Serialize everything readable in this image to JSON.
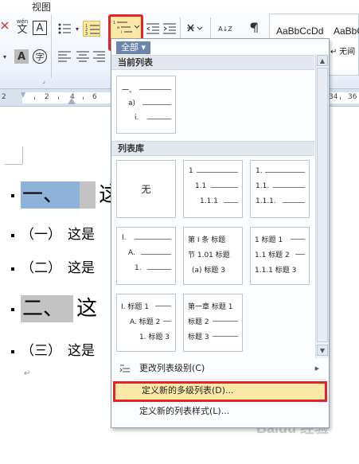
{
  "ribbon": {
    "menu_partial": "视图",
    "font_wen_label": "wén",
    "font_wen_char": "文",
    "char_border_label": "A",
    "char_shading_label": "A",
    "enclosed_char_label": "字",
    "sort_label": "A↓Z",
    "styles": [
      {
        "label": "AaBbCcDd"
      },
      {
        "label": "AaBbC"
      }
    ],
    "style_no_spacing_partial": "↵ 无间"
  },
  "ruler": {
    "numbers": [
      "2",
      "2",
      "4",
      "6",
      "34",
      "36"
    ]
  },
  "document": {
    "paragraphs": [
      {
        "number": "一、",
        "text": "这"
      },
      {
        "number": "（一）",
        "text": "这是"
      },
      {
        "number": "（二）",
        "text": "这是"
      },
      {
        "number": "二、",
        "text": "这"
      },
      {
        "number": "（三）",
        "text": "这是"
      }
    ],
    "para_mark": "↵"
  },
  "dropdown": {
    "filter_label": "全部 ▾",
    "section_current": "当前列表",
    "section_library": "列表库",
    "current_tile": {
      "l1": "一、",
      "l2": "a)",
      "l3": "i."
    },
    "library": {
      "none_label": "无",
      "numeric": {
        "l1": "1",
        "l2": "1.1",
        "l3": "1.1.1"
      },
      "numeric_dot": {
        "l1": "1.",
        "l2": "1.1.",
        "l3": "1.1.1."
      },
      "roman_alpha": {
        "l1": "I.",
        "l2": "A.",
        "l3": "1."
      },
      "article": {
        "l1": "第 I 条 标题",
        "l2": "节 1.01 标题",
        "l3": "(a) 标题 3"
      },
      "numeric_heading": {
        "l1": "1 标题 1",
        "l2": "1.1 标题 2",
        "l3": "1.1.1 标题 3"
      },
      "roman_heading": {
        "l1": "I. 标题 1",
        "l2": "A. 标题 2",
        "l3": "1. 标题 3"
      },
      "chapter": {
        "l1": "第一章 标题 1",
        "l2": "标题 2",
        "l3": "标题 3"
      }
    },
    "commands": {
      "change_level": "更改列表级别(C)",
      "define_multilevel": "定义新的多级列表(D)...",
      "define_style": "定义新的列表样式(L)..."
    }
  },
  "watermark": "Baidu 经验"
}
